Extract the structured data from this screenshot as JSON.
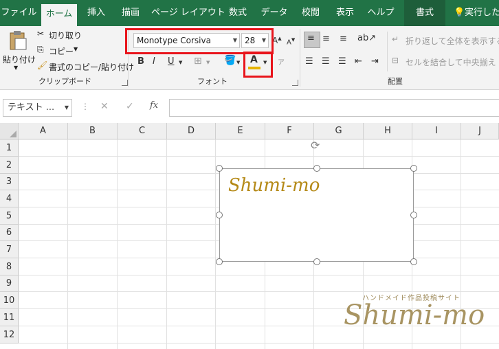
{
  "ribbon_tabs": [
    "ファイル",
    "ホーム",
    "挿入",
    "描画",
    "ページ レイアウト",
    "数式",
    "データ",
    "校閲",
    "表示",
    "ヘルプ",
    "書式",
    "実行した"
  ],
  "clipboard": {
    "paste_label": "貼り付け",
    "cut_label": "切り取り",
    "copy_label": "コピー",
    "format_painter_label": "書式のコピー/貼り付け",
    "group_label": "クリップボード"
  },
  "font": {
    "font_name": "Monotype Corsiva",
    "font_size": "28",
    "bold": "B",
    "italic": "I",
    "underline": "U",
    "font_color_glyph": "A",
    "group_label": "フォント"
  },
  "alignment": {
    "wrap_text_label": "折り返して全体を表示する",
    "merge_center_label": "セルを結合して中央揃え",
    "group_label": "配置"
  },
  "formula_bar": {
    "name_box": "テキスト ...",
    "fx": "fx",
    "cancel": "✕",
    "enter": "✓",
    "formula_value": ""
  },
  "columns": [
    "A",
    "B",
    "C",
    "D",
    "E",
    "F",
    "G",
    "H",
    "I",
    "J"
  ],
  "rows": [
    "1",
    "2",
    "3",
    "4",
    "5",
    "6",
    "7",
    "8",
    "9",
    "10",
    "11",
    "12"
  ],
  "textbox": {
    "text": "Shumi-mo"
  },
  "watermark": {
    "subtitle": "ハンドメイド作品投稿サイト",
    "title": "Shumi-mo"
  },
  "colors": {
    "ribbon_green": "#217346",
    "highlight_red": "#e8141b",
    "shape_text_gold": "#b58a18",
    "font_color_bar": "#e6b300"
  }
}
